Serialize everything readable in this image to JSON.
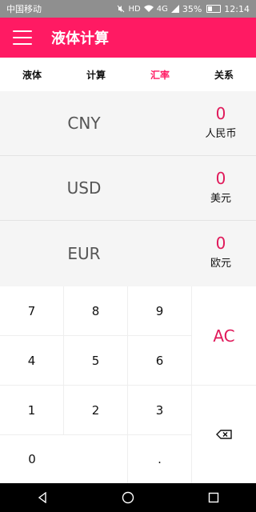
{
  "status_bar": {
    "carrier": "中国移动",
    "battery": "35%",
    "time": "12:14",
    "hd": "HD",
    "net": "4G"
  },
  "app_bar": {
    "title": "液体计算"
  },
  "tabs": [
    {
      "label": "液体"
    },
    {
      "label": "计算"
    },
    {
      "label": "汇率",
      "active": true
    },
    {
      "label": "关系"
    }
  ],
  "currencies": [
    {
      "code": "CNY",
      "amount": "0",
      "name": "人民币"
    },
    {
      "code": "USD",
      "amount": "0",
      "name": "美元"
    },
    {
      "code": "EUR",
      "amount": "0",
      "name": "欧元"
    }
  ],
  "keypad": {
    "k7": "7",
    "k8": "8",
    "k9": "9",
    "k4": "4",
    "k5": "5",
    "k6": "6",
    "k1": "1",
    "k2": "2",
    "k3": "3",
    "k0": "0",
    "dot": ".",
    "clear": "AC"
  },
  "colors": {
    "accent": "#ff1a63",
    "value_red": "#e0195a",
    "status_gray": "#8f8f8f"
  }
}
